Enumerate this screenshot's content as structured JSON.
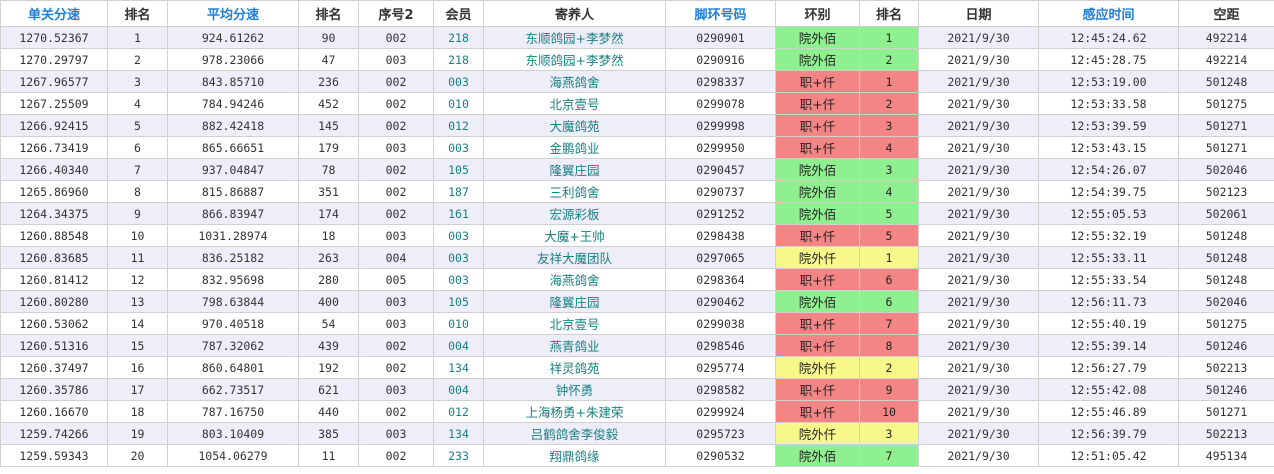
{
  "table": {
    "headers": [
      {
        "label": "单关分速",
        "accent": true
      },
      {
        "label": "排名",
        "accent": false
      },
      {
        "label": "平均分速",
        "accent": true
      },
      {
        "label": "排名",
        "accent": false
      },
      {
        "label": "序号2",
        "accent": false
      },
      {
        "label": "会员",
        "accent": false
      },
      {
        "label": "寄养人",
        "accent": false
      },
      {
        "label": "脚环号码",
        "accent": true
      },
      {
        "label": "环别",
        "accent": false
      },
      {
        "label": "排名",
        "accent": false
      },
      {
        "label": "日期",
        "accent": false
      },
      {
        "label": "感应时间",
        "accent": true
      },
      {
        "label": "空距",
        "accent": false
      }
    ],
    "colors": {
      "accent_header": "#1f7fd6",
      "green": "#8ef08e",
      "red": "#f38585",
      "yellow": "#f7f78a",
      "odd_row": "#eeeefa"
    },
    "rows": [
      [
        "1270.52367",
        "1",
        "924.61262",
        "90",
        "002",
        "218",
        "东顺鸽园+李梦然",
        "0290901",
        "院外佰",
        "1",
        "2021/9/30",
        "12:45:24.62",
        "492214",
        "green"
      ],
      [
        "1270.29797",
        "2",
        "978.23066",
        "47",
        "003",
        "218",
        "东顺鸽园+李梦然",
        "0290916",
        "院外佰",
        "2",
        "2021/9/30",
        "12:45:28.75",
        "492214",
        "green"
      ],
      [
        "1267.96577",
        "3",
        "843.85710",
        "236",
        "002",
        "003",
        "海燕鸽舍",
        "0298337",
        "职+仟",
        "1",
        "2021/9/30",
        "12:53:19.00",
        "501248",
        "red"
      ],
      [
        "1267.25509",
        "4",
        "784.94246",
        "452",
        "002",
        "010",
        "北京壹号",
        "0299078",
        "职+仟",
        "2",
        "2021/9/30",
        "12:53:33.58",
        "501275",
        "red"
      ],
      [
        "1266.92415",
        "5",
        "882.42418",
        "145",
        "002",
        "012",
        "大魔鸽苑",
        "0299998",
        "职+仟",
        "3",
        "2021/9/30",
        "12:53:39.59",
        "501271",
        "red"
      ],
      [
        "1266.73419",
        "6",
        "865.66651",
        "179",
        "003",
        "003",
        "金鹏鸽业",
        "0299950",
        "职+仟",
        "4",
        "2021/9/30",
        "12:53:43.15",
        "501271",
        "red"
      ],
      [
        "1266.40340",
        "7",
        "937.04847",
        "78",
        "002",
        "105",
        "隆翼庄园",
        "0290457",
        "院外佰",
        "3",
        "2021/9/30",
        "12:54:26.07",
        "502046",
        "green"
      ],
      [
        "1265.86960",
        "8",
        "815.86887",
        "351",
        "002",
        "187",
        "三利鸽舍",
        "0290737",
        "院外佰",
        "4",
        "2021/9/30",
        "12:54:39.75",
        "502123",
        "green"
      ],
      [
        "1264.34375",
        "9",
        "866.83947",
        "174",
        "002",
        "161",
        "宏源彩板",
        "0291252",
        "院外佰",
        "5",
        "2021/9/30",
        "12:55:05.53",
        "502061",
        "green"
      ],
      [
        "1260.88548",
        "10",
        "1031.28974",
        "18",
        "003",
        "003",
        "大魔+王帅",
        "0298438",
        "职+仟",
        "5",
        "2021/9/30",
        "12:55:32.19",
        "501248",
        "red"
      ],
      [
        "1260.83685",
        "11",
        "836.25182",
        "263",
        "004",
        "003",
        "友祥大魔团队",
        "0297065",
        "院外仟",
        "1",
        "2021/9/30",
        "12:55:33.11",
        "501248",
        "yellow"
      ],
      [
        "1260.81412",
        "12",
        "832.95698",
        "280",
        "005",
        "003",
        "海燕鸽舍",
        "0298364",
        "职+仟",
        "6",
        "2021/9/30",
        "12:55:33.54",
        "501248",
        "red"
      ],
      [
        "1260.80280",
        "13",
        "798.63844",
        "400",
        "003",
        "105",
        "隆翼庄园",
        "0290462",
        "院外佰",
        "6",
        "2021/9/30",
        "12:56:11.73",
        "502046",
        "green"
      ],
      [
        "1260.53062",
        "14",
        "970.40518",
        "54",
        "003",
        "010",
        "北京壹号",
        "0299038",
        "职+仟",
        "7",
        "2021/9/30",
        "12:55:40.19",
        "501275",
        "red"
      ],
      [
        "1260.51316",
        "15",
        "787.32062",
        "439",
        "002",
        "004",
        "燕青鸽业",
        "0298546",
        "职+仟",
        "8",
        "2021/9/30",
        "12:55:39.14",
        "501246",
        "red"
      ],
      [
        "1260.37497",
        "16",
        "860.64801",
        "192",
        "002",
        "134",
        "祥灵鸽苑",
        "0295774",
        "院外仟",
        "2",
        "2021/9/30",
        "12:56:27.79",
        "502213",
        "yellow"
      ],
      [
        "1260.35786",
        "17",
        "662.73517",
        "621",
        "003",
        "004",
        "钟怀勇",
        "0298582",
        "职+仟",
        "9",
        "2021/9/30",
        "12:55:42.08",
        "501246",
        "red"
      ],
      [
        "1260.16670",
        "18",
        "787.16750",
        "440",
        "002",
        "012",
        "上海杨勇+朱建荣",
        "0299924",
        "职+仟",
        "10",
        "2021/9/30",
        "12:55:46.89",
        "501271",
        "red"
      ],
      [
        "1259.74266",
        "19",
        "803.10409",
        "385",
        "003",
        "134",
        "吕鹤鸽舍李俊毅",
        "0295723",
        "院外仟",
        "3",
        "2021/9/30",
        "12:56:39.79",
        "502213",
        "yellow"
      ],
      [
        "1259.59343",
        "20",
        "1054.06279",
        "11",
        "002",
        "233",
        "翔鼎鸽缘",
        "0290532",
        "院外佰",
        "7",
        "2021/9/30",
        "12:51:05.42",
        "495134",
        "green"
      ]
    ]
  }
}
